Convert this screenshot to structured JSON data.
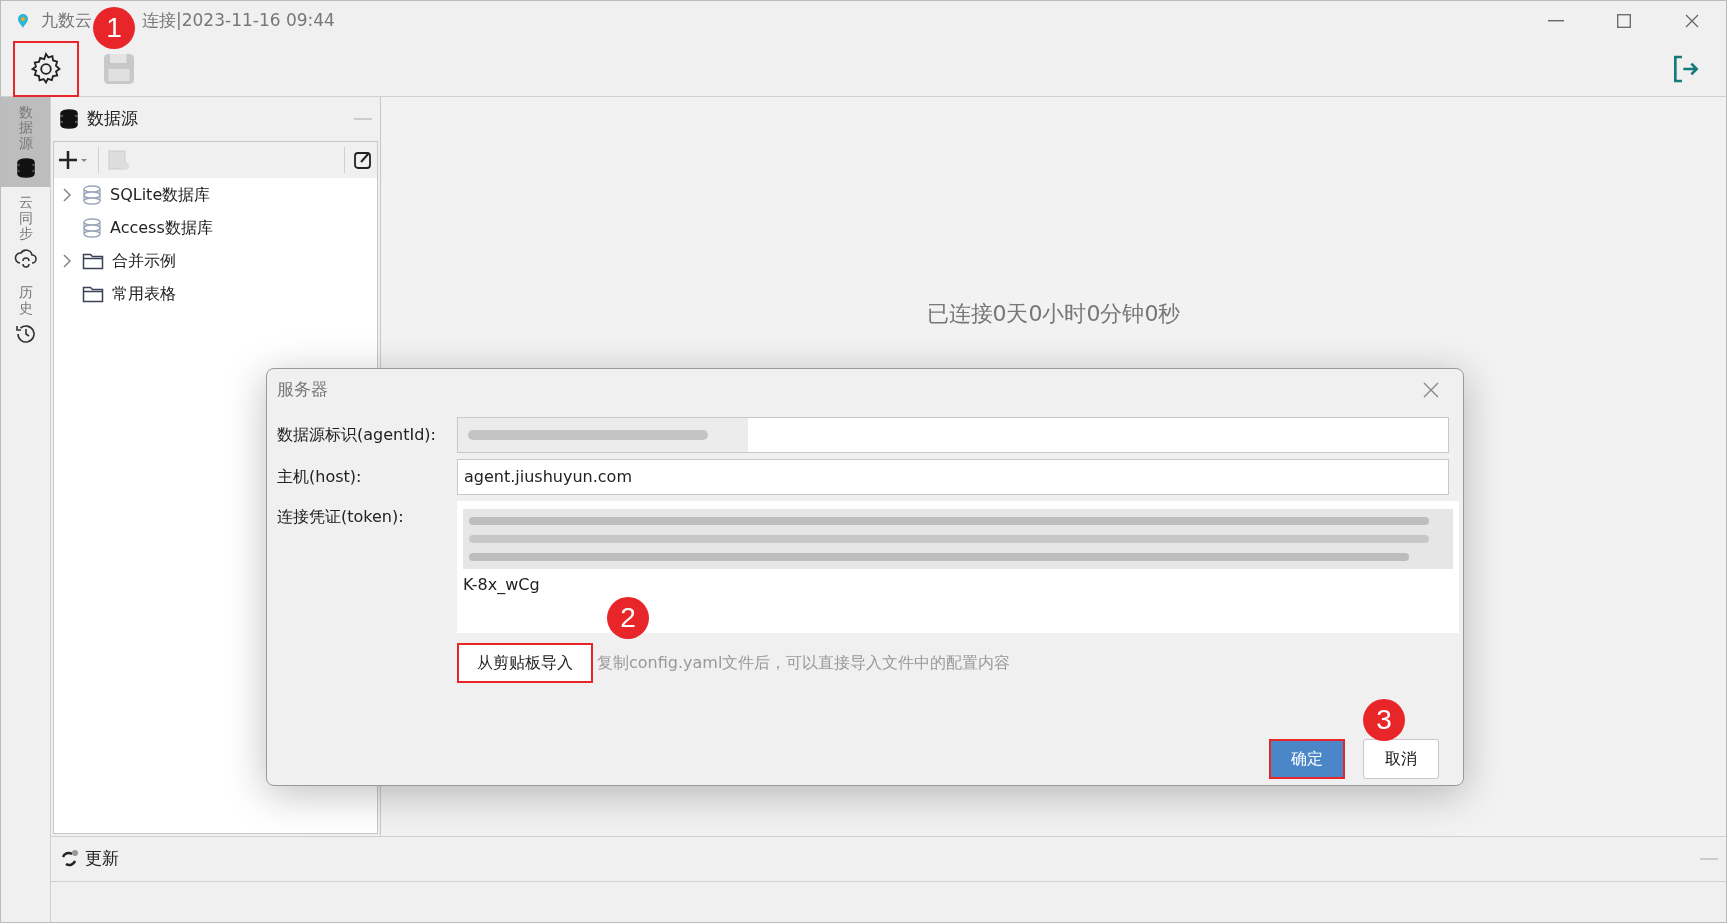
{
  "window": {
    "title_parts": [
      "九数云",
      "连接|2023-11-16 09:44"
    ]
  },
  "toolbar": {
    "buttons": [
      {
        "kind": "settings",
        "disabled": false,
        "highlighted": true,
        "badge": "1"
      },
      {
        "kind": "save",
        "disabled": true,
        "highlighted": false
      }
    ]
  },
  "side_tabs": [
    {
      "label": "数据源",
      "kind": "database",
      "selected": true
    },
    {
      "label": "云同步",
      "kind": "cloud",
      "selected": false
    },
    {
      "label": "历史",
      "kind": "history",
      "selected": false
    }
  ],
  "datasource_panel": {
    "title": "数据源",
    "tree": [
      {
        "label": "SQLite数据库",
        "kind": "database",
        "expandable": true
      },
      {
        "label": "Access数据库",
        "kind": "database",
        "expandable": false
      },
      {
        "label": "合并示例",
        "kind": "folder",
        "expandable": true
      },
      {
        "label": "常用表格",
        "kind": "folder",
        "expandable": false
      }
    ]
  },
  "main": {
    "status": "已连接0天0小时0分钟0秒"
  },
  "dialog": {
    "title": "服务器",
    "fields": [
      {
        "label": "数据源标识(agentId):",
        "kind": "redacted"
      },
      {
        "label": "主机(host):",
        "kind": "text",
        "value": "agent.jiushuyun.com"
      },
      {
        "label": "连接凭证(token):",
        "kind": "token",
        "value": "K-8x_wCg"
      }
    ],
    "import_button": {
      "label": "从剪贴板导入",
      "highlighted": true,
      "badge": "2"
    },
    "hint": "复制config.yaml文件后，可以直接导入文件中的配置内容",
    "buttons": [
      {
        "label": "确定",
        "primary": true,
        "highlighted": true,
        "badge": "3"
      },
      {
        "label": "取消",
        "primary": false,
        "highlighted": false
      }
    ]
  },
  "bottom_panel": {
    "title": "更新"
  }
}
